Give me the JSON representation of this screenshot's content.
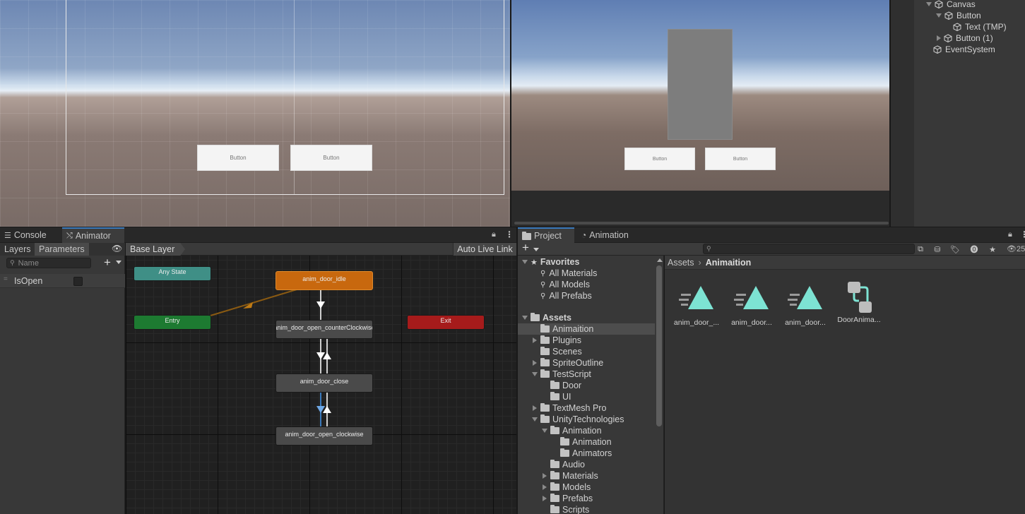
{
  "scene": {
    "buttons": [
      "Button",
      "Button"
    ]
  },
  "game": {
    "buttons": [
      "Button",
      "Button"
    ]
  },
  "hierarchy": {
    "items": [
      {
        "label": "Canvas",
        "expanded": true
      },
      {
        "label": "Button",
        "expanded": true
      },
      {
        "label": "Text (TMP)"
      },
      {
        "label": "Button (1)",
        "expanded": false
      },
      {
        "label": "EventSystem"
      }
    ]
  },
  "animator_panel": {
    "tabs": [
      "Console",
      "Animator"
    ],
    "left_tabs": [
      "Layers",
      "Parameters"
    ],
    "search_placeholder": "Name",
    "parameters": [
      {
        "name": "IsOpen",
        "type": "bool",
        "value": false
      }
    ],
    "breadcrumb": "Base Layer",
    "auto_live_link": "Auto Live Link",
    "nodes": {
      "any_state": "Any State",
      "entry": "Entry",
      "exit": "Exit",
      "idle": "anim_door_idle",
      "open_ccw": "anim_door_open_counterClockwise",
      "close": "anim_door_close",
      "open_cw": "anim_door_open_clockwise"
    },
    "colors": {
      "any_state": "#3f8f86",
      "entry": "#1d7a31",
      "exit": "#a61b1b",
      "default_state": "#c8680e",
      "state": "#4a4a4a"
    }
  },
  "project_panel": {
    "tabs": [
      "Project",
      "Animation"
    ],
    "add_label": "+",
    "visible_count": "25",
    "tree": {
      "favorites_label": "Favorites",
      "favorites": [
        "All Materials",
        "All Models",
        "All Prefabs"
      ],
      "assets_label": "Assets",
      "folders": [
        {
          "label": "Animaition",
          "arrow": "none",
          "level": 1,
          "selected": true
        },
        {
          "label": "Plugins",
          "arrow": "right",
          "level": 1
        },
        {
          "label": "Scenes",
          "arrow": "none",
          "level": 1
        },
        {
          "label": "SpriteOutline",
          "arrow": "right",
          "level": 1
        },
        {
          "label": "TestScript",
          "arrow": "down",
          "level": 1
        },
        {
          "label": "Door",
          "arrow": "none",
          "level": 2
        },
        {
          "label": "UI",
          "arrow": "none",
          "level": 2
        },
        {
          "label": "TextMesh Pro",
          "arrow": "right",
          "level": 1
        },
        {
          "label": "UnityTechnologies",
          "arrow": "down",
          "level": 1
        },
        {
          "label": "Animation",
          "arrow": "down",
          "level": 2
        },
        {
          "label": "Animation",
          "arrow": "none",
          "level": 3
        },
        {
          "label": "Animators",
          "arrow": "none",
          "level": 3
        },
        {
          "label": "Audio",
          "arrow": "none",
          "level": 2
        },
        {
          "label": "Materials",
          "arrow": "right",
          "level": 2
        },
        {
          "label": "Models",
          "arrow": "right",
          "level": 2
        },
        {
          "label": "Prefabs",
          "arrow": "right",
          "level": 2
        },
        {
          "label": "Scripts",
          "arrow": "none",
          "level": 2
        }
      ]
    },
    "breadcrumb": [
      "Assets",
      "Animaition"
    ],
    "assets": [
      {
        "label": "anim_door_...",
        "icon": "animation-clip-icon"
      },
      {
        "label": "anim_door...",
        "icon": "animation-clip-icon"
      },
      {
        "label": "anim_door...",
        "icon": "animation-clip-icon"
      },
      {
        "label": "DoorAnima...",
        "icon": "animator-controller-icon"
      }
    ],
    "accent": "#7de3d3"
  }
}
